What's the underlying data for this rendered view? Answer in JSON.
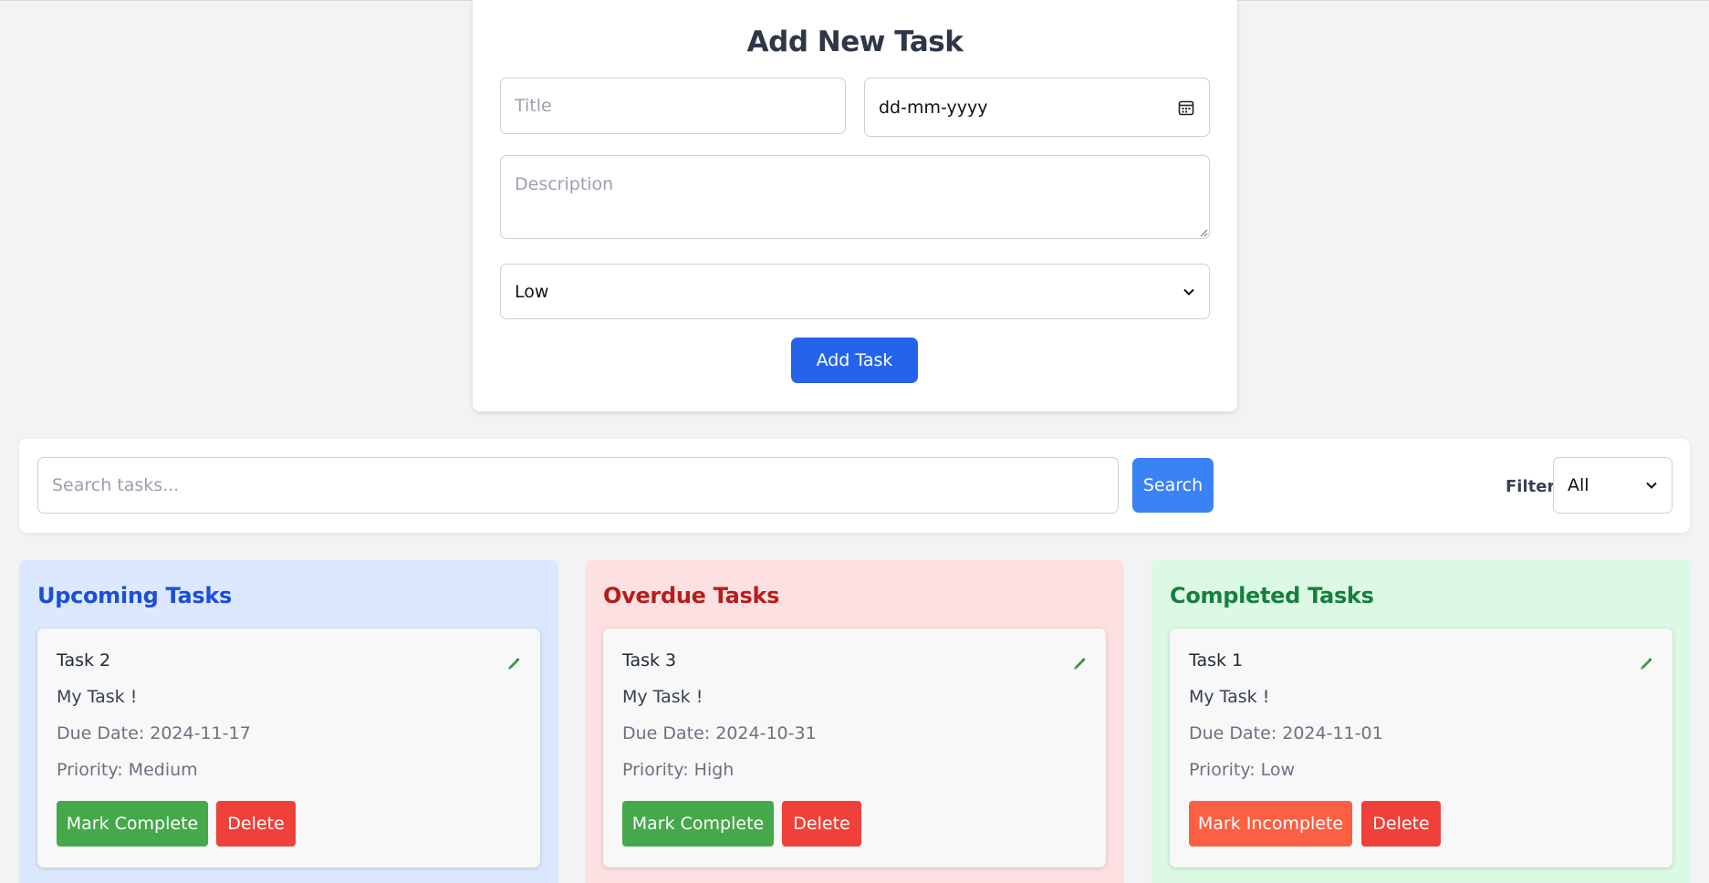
{
  "add_form": {
    "heading": "Add New Task",
    "title_placeholder": "Title",
    "date_value": "dd-mm-yyyy",
    "description_placeholder": "Description",
    "priority_value": "Low",
    "submit_label": "Add Task"
  },
  "search": {
    "placeholder": "Search tasks...",
    "button_label": "Search",
    "filter_label": "Filter",
    "filter_value": "All"
  },
  "columns": [
    {
      "title": "Upcoming Tasks",
      "task": {
        "name": "Task 2",
        "description": "My Task !",
        "due": "Due Date: 2024-11-17",
        "priority": "Priority: Medium",
        "toggle_label": "Mark Complete",
        "delete_label": "Delete"
      }
    },
    {
      "title": "Overdue Tasks",
      "task": {
        "name": "Task 3",
        "description": "My Task !",
        "due": "Due Date: 2024-10-31",
        "priority": "Priority: High",
        "toggle_label": "Mark Complete",
        "delete_label": "Delete"
      }
    },
    {
      "title": "Completed Tasks",
      "task": {
        "name": "Task 1",
        "description": "My Task !",
        "due": "Due Date: 2024-11-01",
        "priority": "Priority: Low",
        "toggle_label": "Mark Incomplete",
        "delete_label": "Delete"
      }
    }
  ],
  "colors": {
    "primary": "#2563eb",
    "search_button": "#3b82f6",
    "complete_button": "#45a84a",
    "incomplete_button": "#fb6043",
    "delete_button": "#ef4139",
    "upcoming_bg": "#dce8fd",
    "overdue_bg": "#fde1e2",
    "completed_bg": "#dbf9e4"
  },
  "icons": {
    "date": "calendar-icon",
    "edit": "pencil-icon",
    "dropdown": "chevron-down-icon"
  }
}
